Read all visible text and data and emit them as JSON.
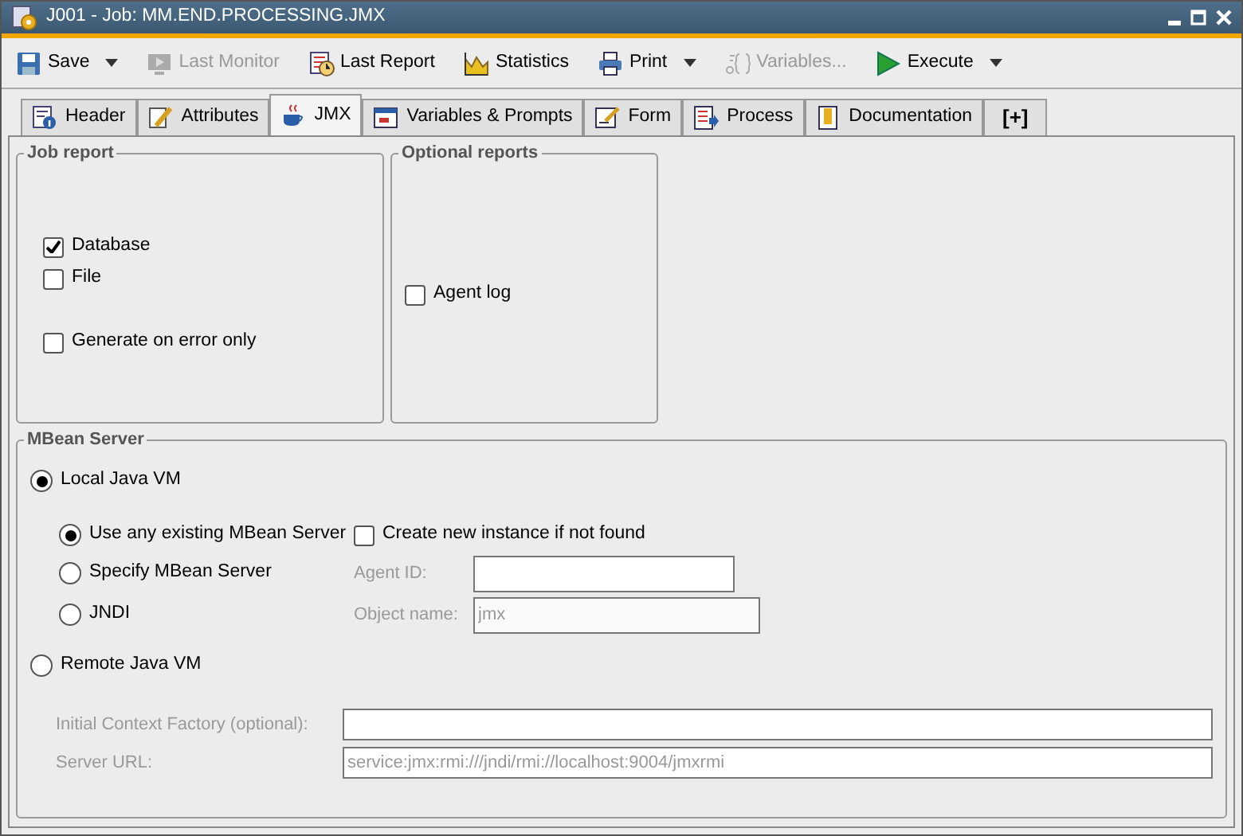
{
  "window": {
    "title": "J001 - Job: MM.END.PROCESSING.JMX"
  },
  "toolbar": [
    {
      "label": "Save",
      "disabled": false,
      "dropdown": true
    },
    {
      "label": "Last Monitor",
      "disabled": true,
      "dropdown": false
    },
    {
      "label": "Last Report",
      "disabled": false,
      "dropdown": false
    },
    {
      "label": "Statistics",
      "disabled": false,
      "dropdown": false
    },
    {
      "label": "Print",
      "disabled": false,
      "dropdown": true
    },
    {
      "label": "Variables...",
      "disabled": true,
      "dropdown": false
    },
    {
      "label": "Execute",
      "disabled": false,
      "dropdown": true
    }
  ],
  "tabs": [
    {
      "label": "Header",
      "selected": false
    },
    {
      "label": "Attributes",
      "selected": false
    },
    {
      "label": "JMX",
      "selected": true
    },
    {
      "label": "Variables & Prompts",
      "selected": false
    },
    {
      "label": "Form",
      "selected": false
    },
    {
      "label": "Process",
      "selected": false
    },
    {
      "label": "Documentation",
      "selected": false
    },
    {
      "label": "[+]",
      "selected": false
    }
  ],
  "job_report": {
    "title": "Job report",
    "options": [
      {
        "label": "Database",
        "checked": true
      },
      {
        "label": "File",
        "checked": false
      },
      {
        "label": "Generate on error only",
        "checked": false
      }
    ]
  },
  "optional_reports": {
    "title": "Optional reports",
    "options": [
      {
        "label": "Agent log",
        "checked": false
      }
    ]
  },
  "mbean_server": {
    "title": "MBean Server",
    "local": {
      "label": "Local Java VM",
      "selected": true
    },
    "local_options": [
      {
        "label": "Use any existing MBean Server",
        "selected": true
      },
      {
        "label": "Specify MBean Server",
        "selected": false
      },
      {
        "label": "JNDI",
        "selected": false
      }
    ],
    "create_new": {
      "label": "Create new instance if not found",
      "checked": false
    },
    "agent_id": {
      "label": "Agent ID:",
      "disabled": true
    },
    "object_name": {
      "label": "Object name:",
      "value": "jmx",
      "disabled": true
    },
    "remote": {
      "label": "Remote Java VM",
      "selected": false
    },
    "initial_context_factory": {
      "label": "Initial Context Factory (optional):",
      "disabled": true
    },
    "server_url": {
      "label": "Server URL:",
      "value": "service:jmx:rmi:///jndi/rmi://localhost:9004/jmxrmi",
      "disabled": true
    }
  }
}
